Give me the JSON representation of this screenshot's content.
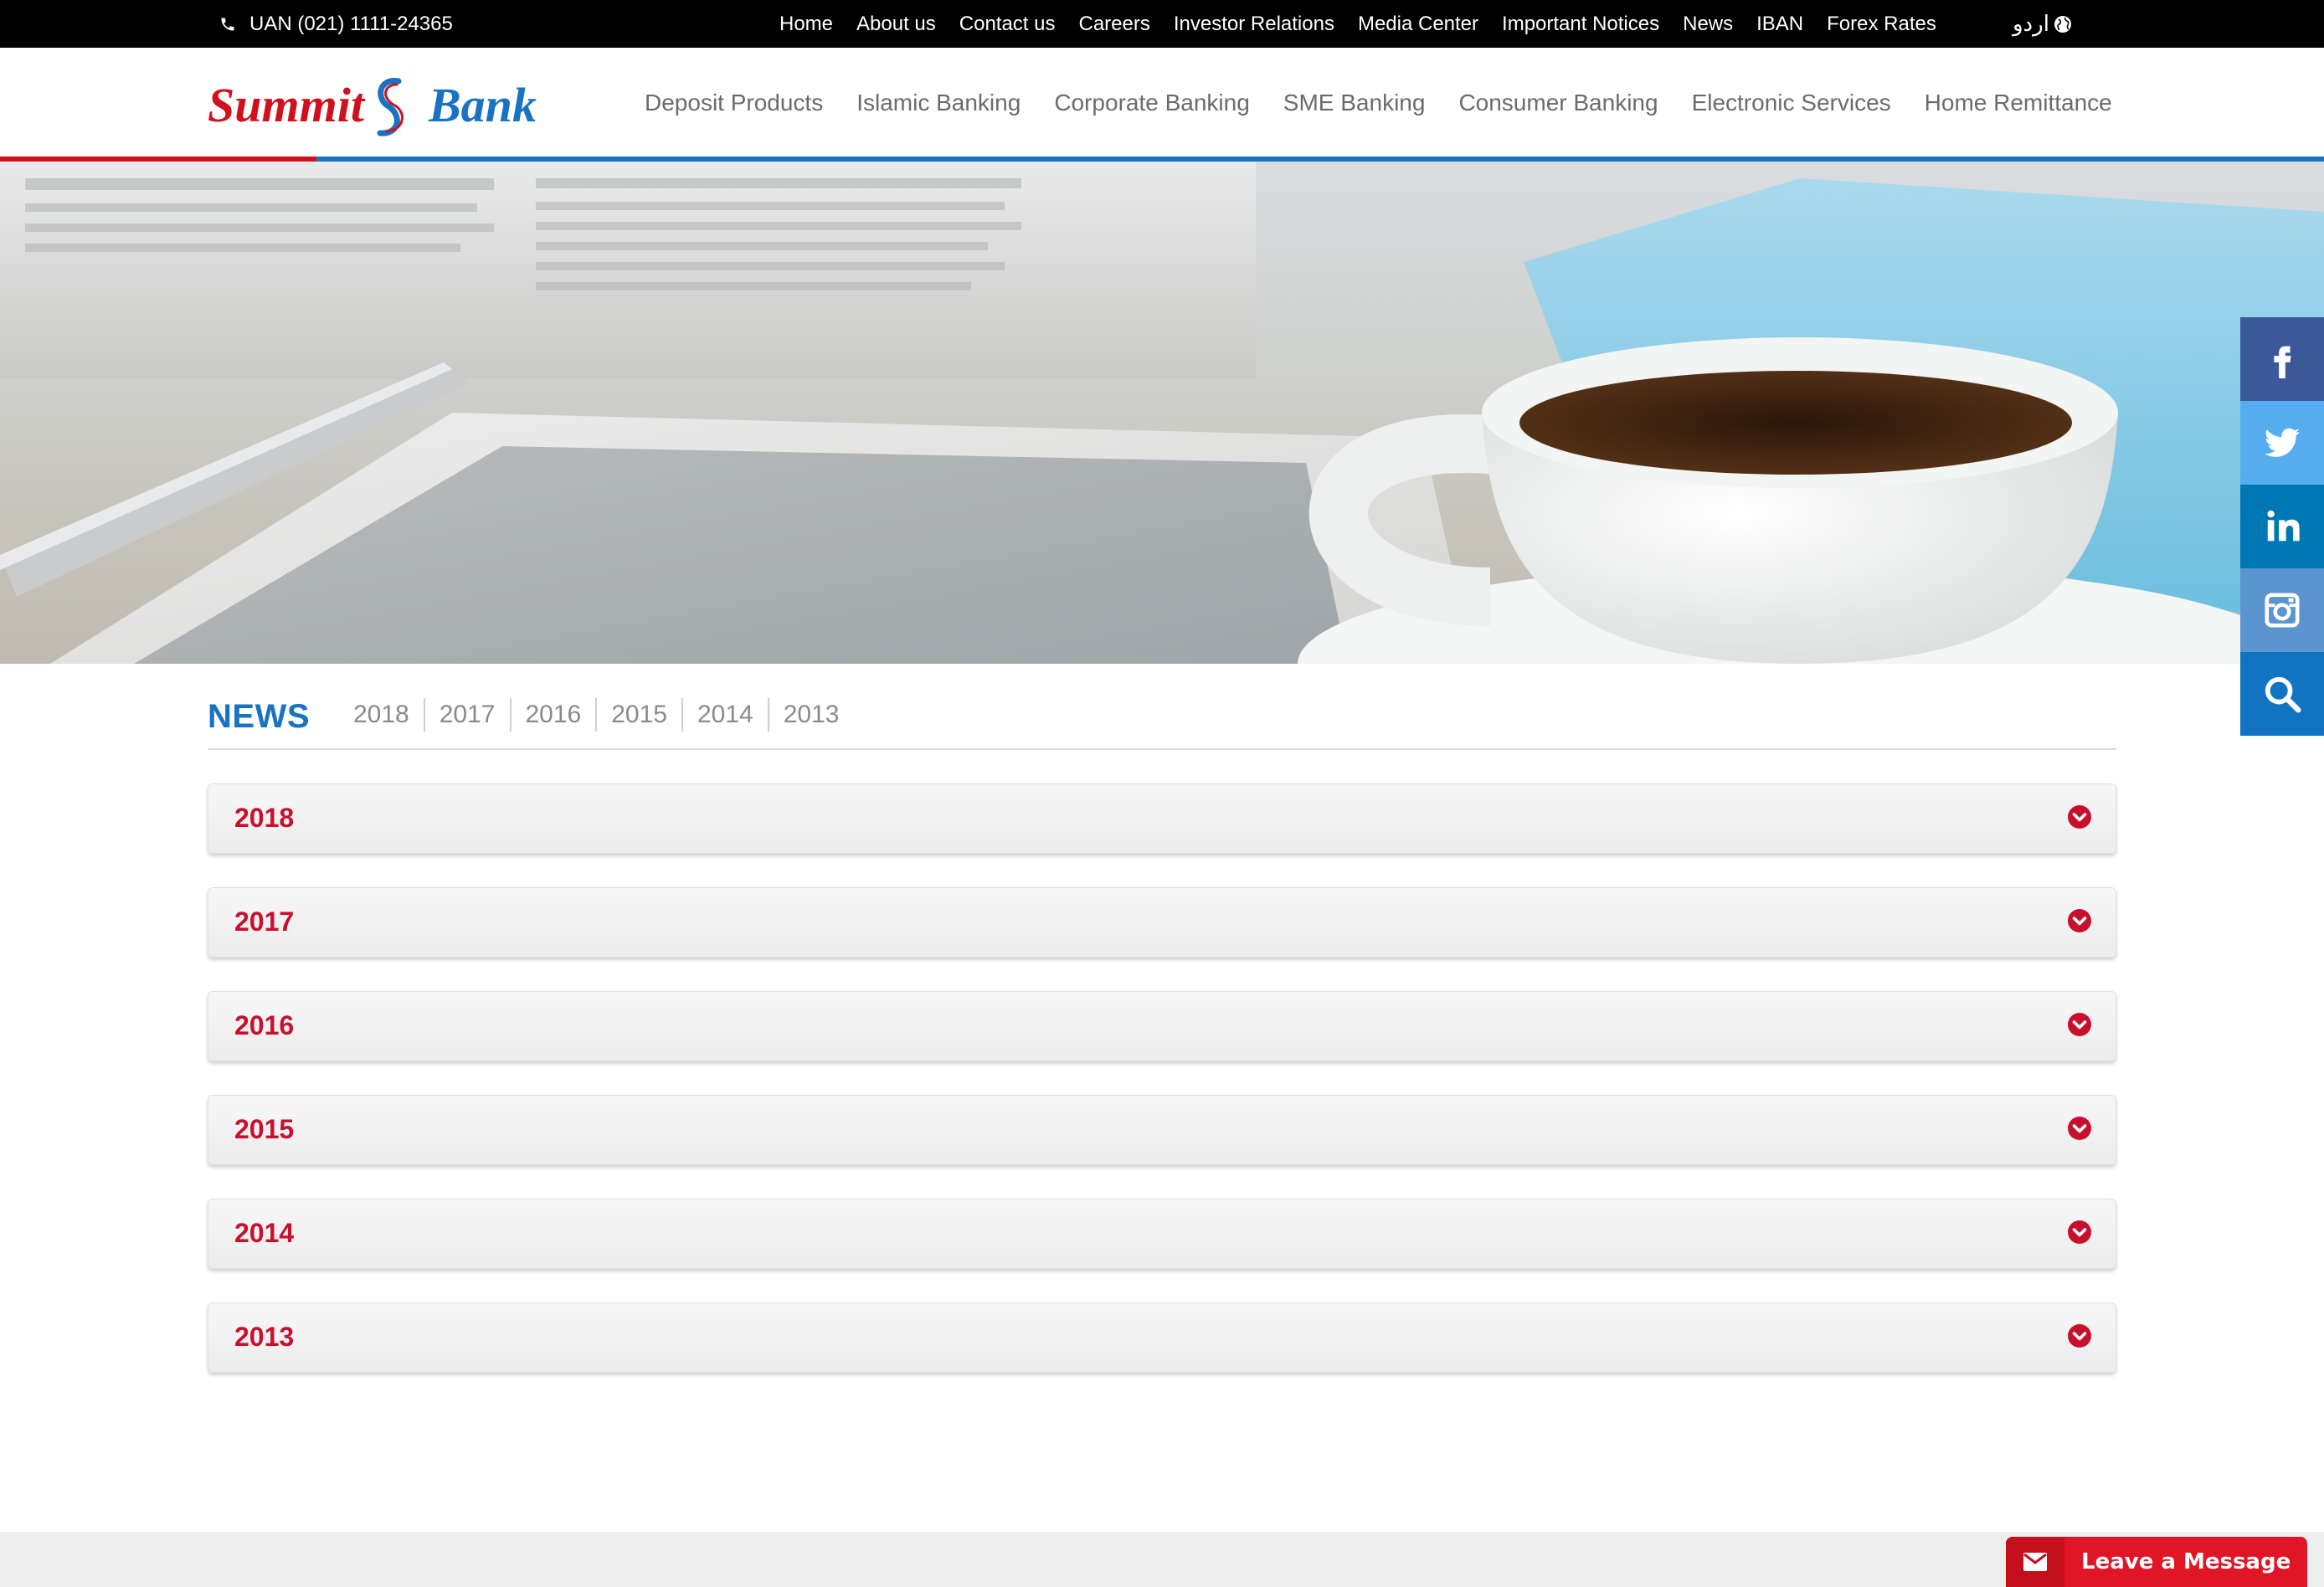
{
  "topbar": {
    "phone": "UAN (021) 1111-24365",
    "links": [
      "Home",
      "About us",
      "Contact us",
      "Careers",
      "Investor Relations",
      "Media Center",
      "Important Notices",
      "News",
      "IBAN",
      "Forex Rates"
    ],
    "language": "اردو"
  },
  "brand": {
    "part1": "Summit",
    "part2": "Bank",
    "red": "#d0111d",
    "blue": "#1a72c2"
  },
  "main_nav": [
    "Deposit Products",
    "Islamic Banking",
    "Corporate Banking",
    "SME Banking",
    "Consumer Banking",
    "Electronic Services",
    "Home Remittance"
  ],
  "social": [
    "facebook-icon",
    "twitter-icon",
    "linkedin-icon",
    "instagram-icon",
    "search-icon"
  ],
  "news": {
    "title": "NEWS",
    "year_tabs": [
      "2018",
      "2017",
      "2016",
      "2015",
      "2014",
      "2013"
    ],
    "accordion": [
      "2018",
      "2017",
      "2016",
      "2015",
      "2014",
      "2013"
    ]
  },
  "chat": {
    "label": "Leave a Message"
  },
  "colors": {
    "accent_red": "#c8102e",
    "accent_blue": "#1a72c2",
    "message_red": "#e01626"
  }
}
